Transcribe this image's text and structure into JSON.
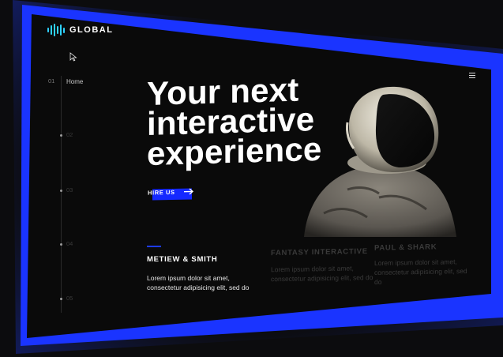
{
  "brand": {
    "name": "GLOBAL"
  },
  "nav": {
    "items": [
      {
        "num": "01",
        "label": "Home"
      },
      {
        "num": "02",
        "label": ""
      },
      {
        "num": "03",
        "label": ""
      },
      {
        "num": "04",
        "label": ""
      },
      {
        "num": "05",
        "label": ""
      }
    ]
  },
  "hero": {
    "lines": [
      "Your next",
      "interactive",
      "experience"
    ],
    "cta_label": "HIRE US"
  },
  "credits": [
    {
      "title": "METIEW & SMITH",
      "desc": "Lorem ipsum dolor sit amet, consectetur adipisicing elit, sed do"
    },
    {
      "title": "FANTASY INTERACTIVE",
      "desc": "Lorem ipsum dolor sit amet, consectetur adipisicing elit, sed do"
    },
    {
      "title": "PAUL & SHARK",
      "desc": "Lorem ipsum dolor sit amet, consectetur adipisicing elit, sed do"
    }
  ],
  "colors": {
    "accent": "#1428ff",
    "logo": "#2fd3ff",
    "background": "#0a0a0a"
  },
  "icons": [
    "logo-bars-icon",
    "cursor-icon",
    "menu-icon",
    "arrow-right-icon"
  ]
}
